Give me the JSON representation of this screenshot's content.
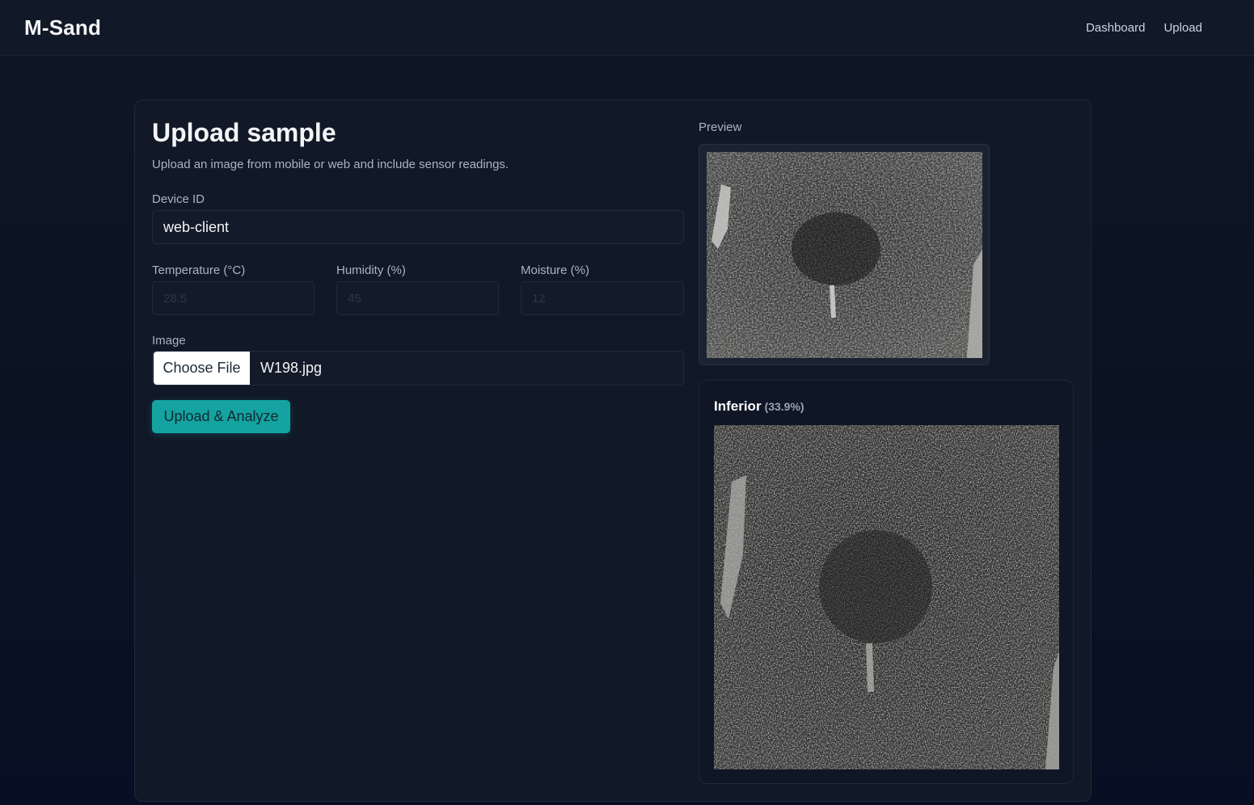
{
  "header": {
    "brand": "M-Sand",
    "nav": [
      "Dashboard",
      "Upload"
    ]
  },
  "form": {
    "title": "Upload sample",
    "subtitle": "Upload an image from mobile or web and include sensor readings.",
    "device_id": {
      "label": "Device ID",
      "value": "web-client"
    },
    "temperature": {
      "label": "Temperature (°C)",
      "placeholder": "28.5"
    },
    "humidity": {
      "label": "Humidity (%)",
      "placeholder": "45"
    },
    "moisture": {
      "label": "Moisture (%)",
      "placeholder": "12"
    },
    "image": {
      "label": "Image",
      "button": "Choose File",
      "file_name": "W198.jpg"
    },
    "submit_label": "Upload & Analyze"
  },
  "preview": {
    "label": "Preview"
  },
  "result": {
    "class_label": "Inferior",
    "confidence": "(33.9%)"
  },
  "colors": {
    "accent": "#14a3a0",
    "card": "#111827",
    "background": "#0b1323"
  }
}
